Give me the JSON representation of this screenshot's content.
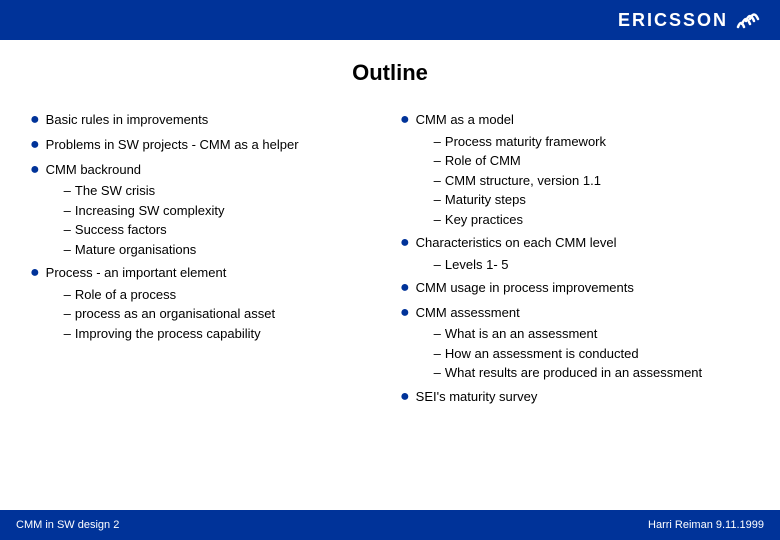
{
  "header": {
    "company": "ERICSSON"
  },
  "title": "Outline",
  "left_column": {
    "bullets": [
      {
        "text": "Basic rules in improvements",
        "sub": []
      },
      {
        "text": "Problems in SW projects - CMM as a helper",
        "sub": []
      },
      {
        "text": "CMM backround",
        "sub": [
          "The SW crisis",
          "Increasing SW complexity",
          "Success factors",
          "Mature organisations"
        ]
      },
      {
        "text": "Process - an important element",
        "sub": [
          "Role of a process",
          "process as an organisational asset",
          "Improving the process capability"
        ]
      }
    ]
  },
  "right_column": {
    "bullets": [
      {
        "text": "CMM as a model",
        "sub": [
          "Process maturity framework",
          "Role of CMM",
          "CMM structure, version 1.1",
          "Maturity steps",
          "Key practices"
        ]
      },
      {
        "text": "Characteristics on each CMM level",
        "sub": [
          "Levels 1- 5"
        ]
      },
      {
        "text": "CMM usage in process improvements",
        "sub": []
      },
      {
        "text": "CMM assessment",
        "sub": [
          "What is an an assessment",
          "How an assessment  is conducted",
          "What results are produced in an assessment"
        ]
      },
      {
        "text": "SEI's maturity survey",
        "sub": []
      }
    ]
  },
  "footer": {
    "left": "CMM in  SW design   2",
    "right": "Harri Reiman 9.11.1999"
  }
}
